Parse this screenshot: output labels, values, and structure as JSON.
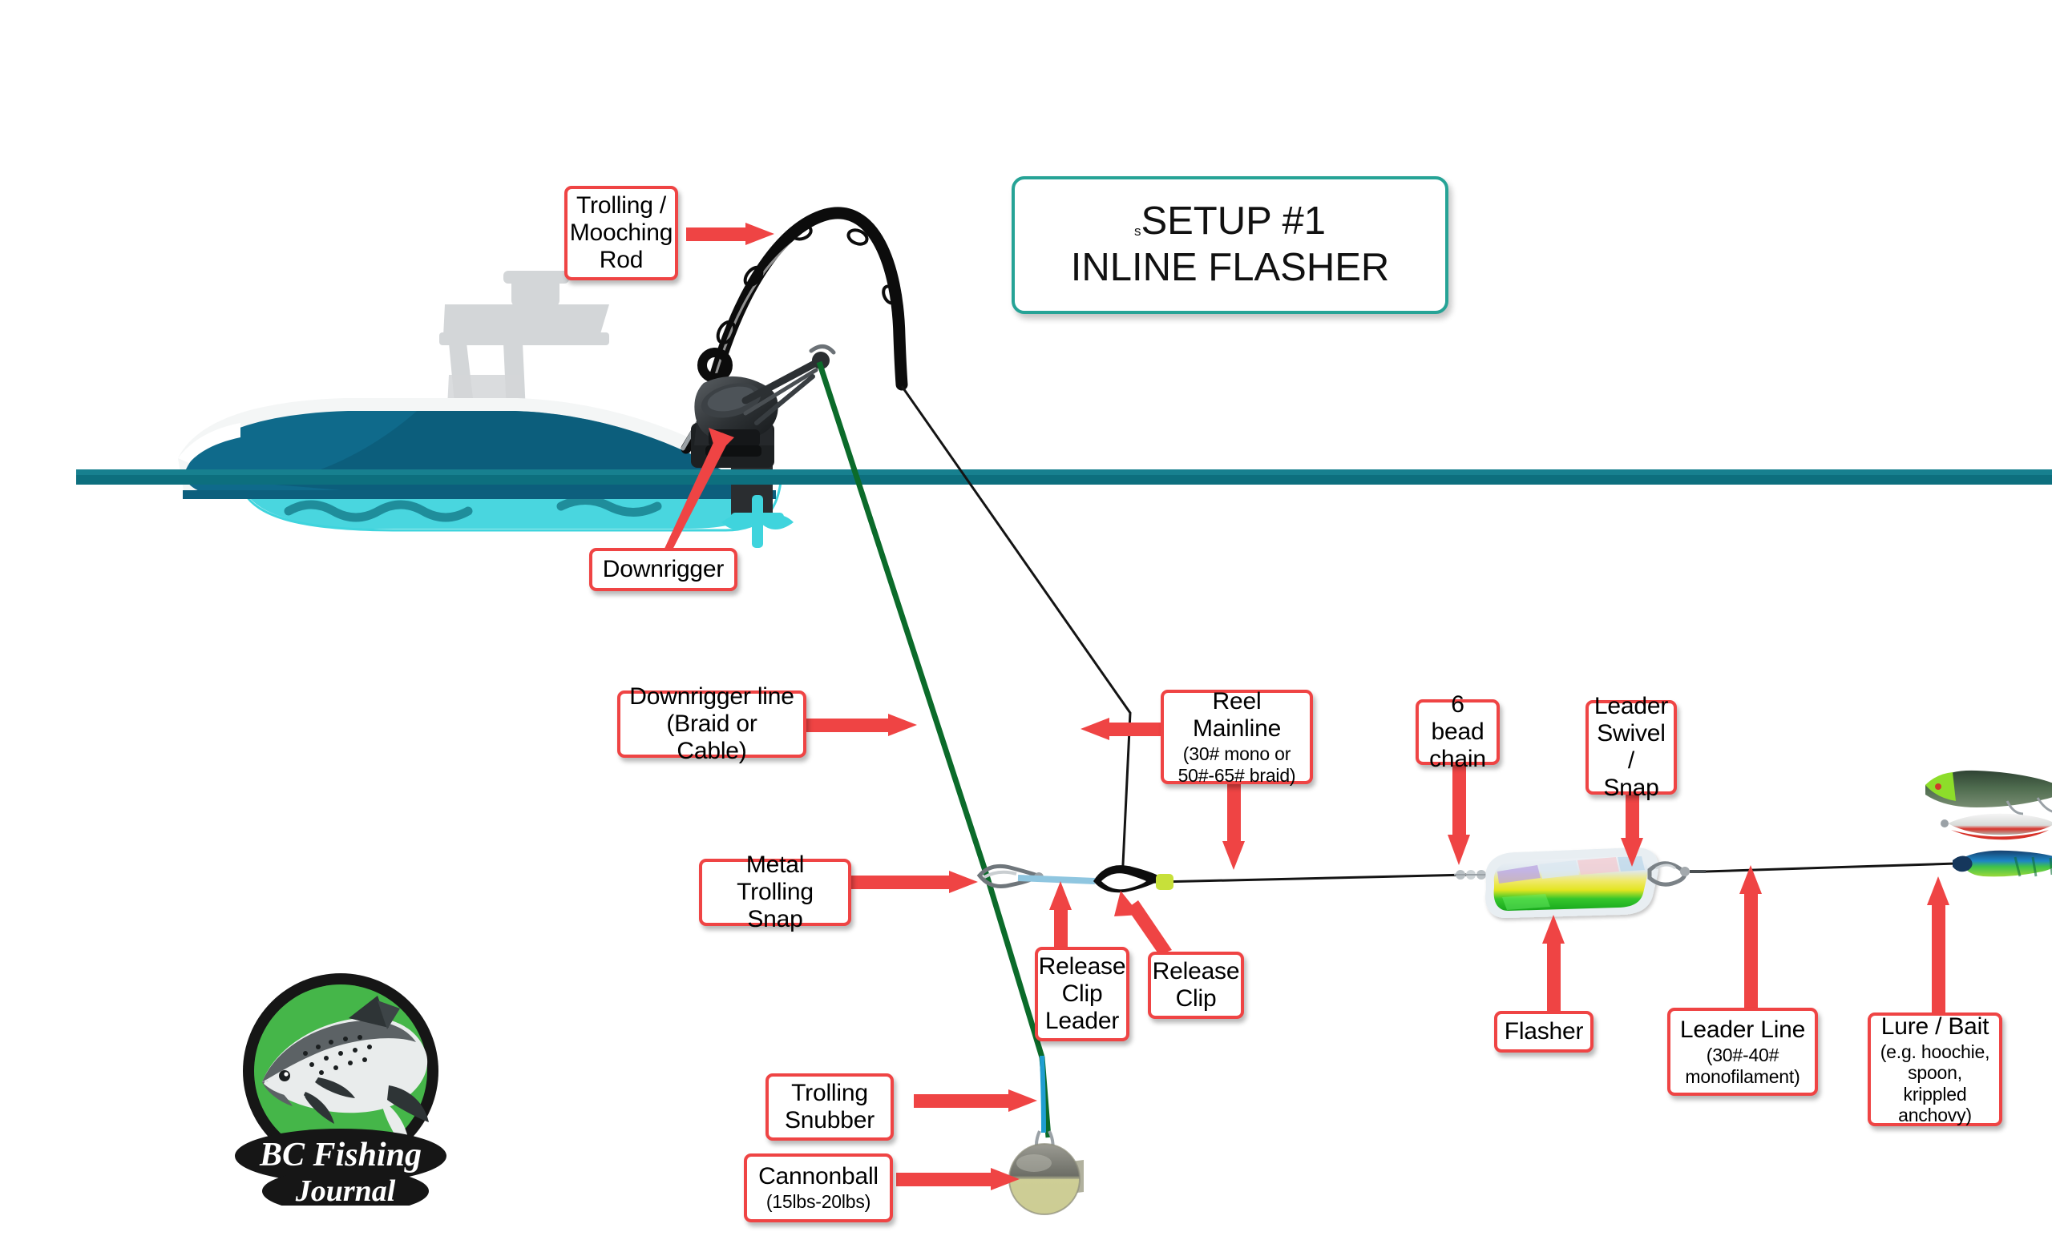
{
  "title": {
    "prefix": "s",
    "line1": "SETUP #1",
    "line2": "INLINE FLASHER",
    "border_color": "#26a396"
  },
  "logo": {
    "line1": "BC Fishing",
    "line2": "Journal",
    "circle_color": "#45b649",
    "ring_color": "#161616"
  },
  "colors": {
    "callout_border": "#ef4444",
    "arrow": "#ef4444",
    "water_line": "#17808f",
    "hull": "#0f6a8b",
    "hull_dark": "#0b5371",
    "hull_underwater": "#3fd4dd",
    "downrigger_line": "#0b6b2a",
    "release_clip_leader": "#8fc6e0",
    "mainline": "#111111",
    "flasher_green": "#22c024",
    "flasher_yellow": "#e9e52a"
  },
  "labels": [
    {
      "id": "trolling-mooching-rod",
      "title": "Trolling /\nMooching\nRod",
      "sub": ""
    },
    {
      "id": "downrigger",
      "title": "Downrigger",
      "sub": ""
    },
    {
      "id": "downrigger-line",
      "title": "Downrigger line\n(Braid or Cable)",
      "sub": ""
    },
    {
      "id": "reel-mainline",
      "title": "Reel Mainline",
      "sub": "(30# mono or\n50#-65# braid)"
    },
    {
      "id": "metal-trolling-snap",
      "title": "Metal Trolling\nSnap",
      "sub": ""
    },
    {
      "id": "release-clip-leader",
      "title": "Release\nClip\nLeader",
      "sub": ""
    },
    {
      "id": "release-clip",
      "title": "Release\nClip",
      "sub": ""
    },
    {
      "id": "bead-chain",
      "title": "6 bead\nchain",
      "sub": ""
    },
    {
      "id": "leader-swivel-snap",
      "title": "Leader\nSwivel /\nSnap",
      "sub": ""
    },
    {
      "id": "flasher",
      "title": "Flasher",
      "sub": ""
    },
    {
      "id": "leader-line",
      "title": "Leader Line",
      "sub": "(30#-40#\nmonofilament)"
    },
    {
      "id": "lure-bait",
      "title": "Lure / Bait",
      "sub": "(e.g. hoochie,\nspoon, krippled\nanchovy)"
    },
    {
      "id": "trolling-snubber",
      "title": "Trolling\nSnubber",
      "sub": ""
    },
    {
      "id": "cannonball",
      "title": "Cannonball",
      "sub": "(15lbs-20lbs)"
    }
  ]
}
